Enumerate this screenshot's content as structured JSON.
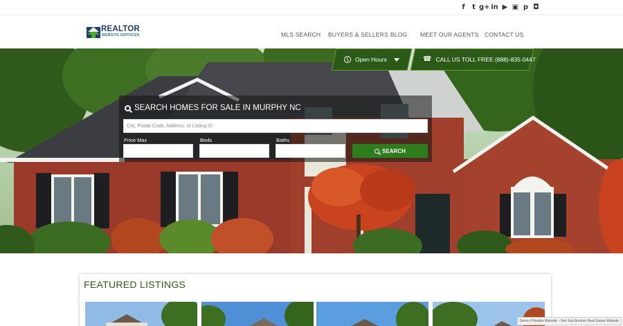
{
  "social": {
    "icons": [
      "facebook-icon",
      "twitter-icon",
      "google-plus-icon",
      "linkedin-icon",
      "youtube-icon",
      "flickr-icon",
      "pinterest-icon",
      "instagram-icon"
    ],
    "glyphs": [
      "f",
      "t",
      "g+",
      "in",
      "▶",
      "▣",
      "p",
      "◘"
    ]
  },
  "logo": {
    "word1": "REALTOR",
    "word2": "WEBSITE SERVICES"
  },
  "nav": {
    "items": [
      "MLS SEARCH",
      "BUYERS & SELLERS",
      "BLOG",
      "MEET OUR AGENTS",
      "CONTACT US"
    ]
  },
  "tabs": {
    "hours_label": "Open Hours",
    "call_label": "CALL US TOLL FREE (888)-835-0447"
  },
  "search": {
    "title": "SEARCH HOMES FOR SALE IN MURPHY NC",
    "main_placeholder": "City, Postal Code, Address, or Listing ID",
    "price_label": "Price Max",
    "beds_label": "Beds",
    "baths_label": "Baths",
    "button_label": "SEARCH"
  },
  "featured": {
    "title": "FEATURED LISTINGS"
  },
  "footer": {
    "badge": "Demo 4 Realtor Website – Not Just Another Real Estate Website"
  },
  "colors": {
    "accent_green": "#2e7d1c",
    "dark_green": "#2b5a16",
    "title_green": "#2f5a12",
    "logo_blue": "#1e3d6e"
  }
}
